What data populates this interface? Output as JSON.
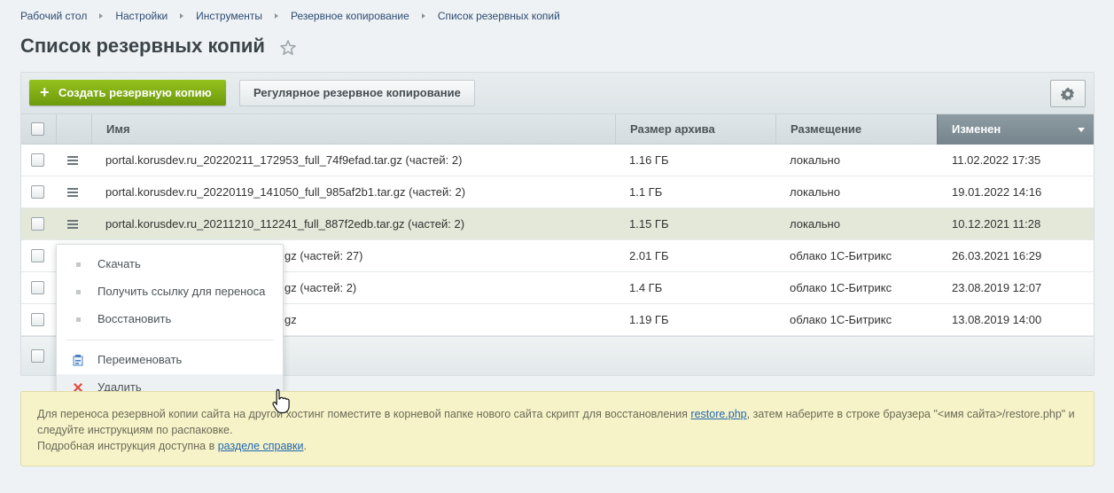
{
  "breadcrumb": [
    "Рабочий стол",
    "Настройки",
    "Инструменты",
    "Резервное копирование",
    "Список резервных копий"
  ],
  "page": {
    "title": "Список резервных копий"
  },
  "toolbar": {
    "create_label": "Создать резервную копию",
    "regular_label": "Регулярное резервное копирование"
  },
  "table": {
    "columns": {
      "name": "Имя",
      "size": "Размер архива",
      "location": "Размещение",
      "modified": "Изменен"
    },
    "rows": [
      {
        "name": "portal.korusdev.ru_20220211_172953_full_74f9efad.tar.gz (частей: 2)",
        "size": "1.16 ГБ",
        "location": "локально",
        "modified": "11.02.2022 17:35"
      },
      {
        "name": "portal.korusdev.ru_20220119_141050_full_985af2b1.tar.gz (частей: 2)",
        "size": "1.1 ГБ",
        "location": "локально",
        "modified": "19.01.2022 14:16"
      },
      {
        "name": "portal.korusdev.ru_20211210_112241_full_887f2edb.tar.gz (частей: 2)",
        "size": "1.15 ГБ",
        "location": "локально",
        "modified": "10.12.2021 11:28"
      },
      {
        "name": "gz (частей: 27)",
        "size": "2.01 ГБ",
        "location": "облако 1С-Битрикс",
        "modified": "26.03.2021 16:29"
      },
      {
        "name": "gz (частей: 2)",
        "size": "1.4 ГБ",
        "location": "облако 1С-Битрикс",
        "modified": "23.08.2019 12:07"
      },
      {
        "name": "gz",
        "size": "1.19 ГБ",
        "location": "облако 1С-Битрикс",
        "modified": "13.08.2019 14:00"
      }
    ]
  },
  "context_menu": {
    "download": "Скачать",
    "get_link": "Получить ссылку для переноса",
    "restore": "Восстановить",
    "rename": "Переименовать",
    "delete": "Удалить"
  },
  "info": {
    "line1_a": "Для переноса резервной копии сайта на другой хостинг поместите в корневой папке нового сайта скрипт для восстановления ",
    "restore_link": "restore.php",
    "line1_b": ", затем наберите в строке браузера \"<имя сайта>/restore.php\" и следуйте инструкциям по распаковке.",
    "line2_a": "Подробная инструкция доступна в ",
    "help_link": "разделе справки",
    "line2_b": "."
  },
  "colors": {
    "create_button": "#7aab10",
    "sorted_header": "#84939a",
    "highlight_row": "#e3e8d8",
    "info_bg": "#f7f3c9"
  }
}
